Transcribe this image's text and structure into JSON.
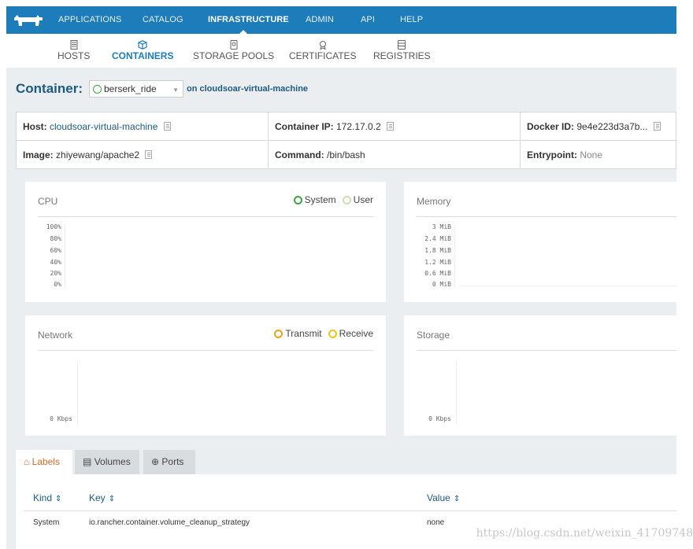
{
  "topnav": {
    "logo_icon": "rancher-logo-icon",
    "items": [
      {
        "label": "APPLICATIONS"
      },
      {
        "label": "CATALOG"
      },
      {
        "label": "INFRASTRUCTURE",
        "active": true
      },
      {
        "label": "ADMIN"
      },
      {
        "label": "API"
      },
      {
        "label": "HELP"
      }
    ]
  },
  "subnav": {
    "items": [
      {
        "label": "HOSTS",
        "icon": "server-icon"
      },
      {
        "label": "CONTAINERS",
        "icon": "cube-icon",
        "active": true
      },
      {
        "label": "STORAGE POOLS",
        "icon": "disk-icon"
      },
      {
        "label": "CERTIFICATES",
        "icon": "certificate-icon"
      },
      {
        "label": "REGISTRIES",
        "icon": "registry-icon"
      }
    ]
  },
  "container": {
    "label": "Container:",
    "selected": "berserk_ride",
    "on_text": "on cloudsoar-virtual-machine"
  },
  "info": {
    "host_key": "Host:",
    "host_value": "cloudsoar-virtual-machine",
    "ip_key": "Container IP:",
    "ip_value": "172.17.0.2",
    "docker_key": "Docker ID:",
    "docker_value": "9e4e223d3a7b...",
    "image_key": "Image:",
    "image_value": "zhiyewang/apache2",
    "command_key": "Command:",
    "command_value": "/bin/bash",
    "entry_key": "Entrypoint:",
    "entry_value": "None"
  },
  "panels": {
    "cpu": {
      "title": "CPU",
      "legend": [
        "System",
        "User"
      ],
      "ticks": [
        "100%",
        "80%",
        "60%",
        "40%",
        "20%",
        "0%"
      ]
    },
    "memory": {
      "title": "Memory",
      "ticks": [
        "3 MiB",
        "2.4 MiB",
        "1.8 MiB",
        "1.2 MiB",
        "0.6 MiB",
        "0 MiB"
      ]
    },
    "network": {
      "title": "Network",
      "legend": [
        "Transmit",
        "Receive"
      ],
      "ticks": [
        "0 Kbps"
      ]
    },
    "storage": {
      "title": "Storage",
      "ticks": [
        "0 Kbps"
      ]
    }
  },
  "colors": {
    "nav_bg": "#1d7dba",
    "system": "#3ca543",
    "user": "#c7e2b0",
    "transmit": "#e8a31a",
    "receive": "#e8c51a",
    "active_tab": "#e06a2a"
  },
  "tabs": [
    {
      "label": "Labels",
      "icon": "tag-icon",
      "active": true
    },
    {
      "label": "Volumes",
      "icon": "volume-icon"
    },
    {
      "label": "Ports",
      "icon": "ports-icon"
    }
  ],
  "labels_table": {
    "headers": [
      "Kind",
      "Key",
      "Value"
    ],
    "rows": [
      {
        "kind": "System",
        "key": "io.rancher.container.volume_cleanup_strategy",
        "value": "none"
      }
    ]
  },
  "watermark": "https://blog.csdn.net/weixin_41709748"
}
